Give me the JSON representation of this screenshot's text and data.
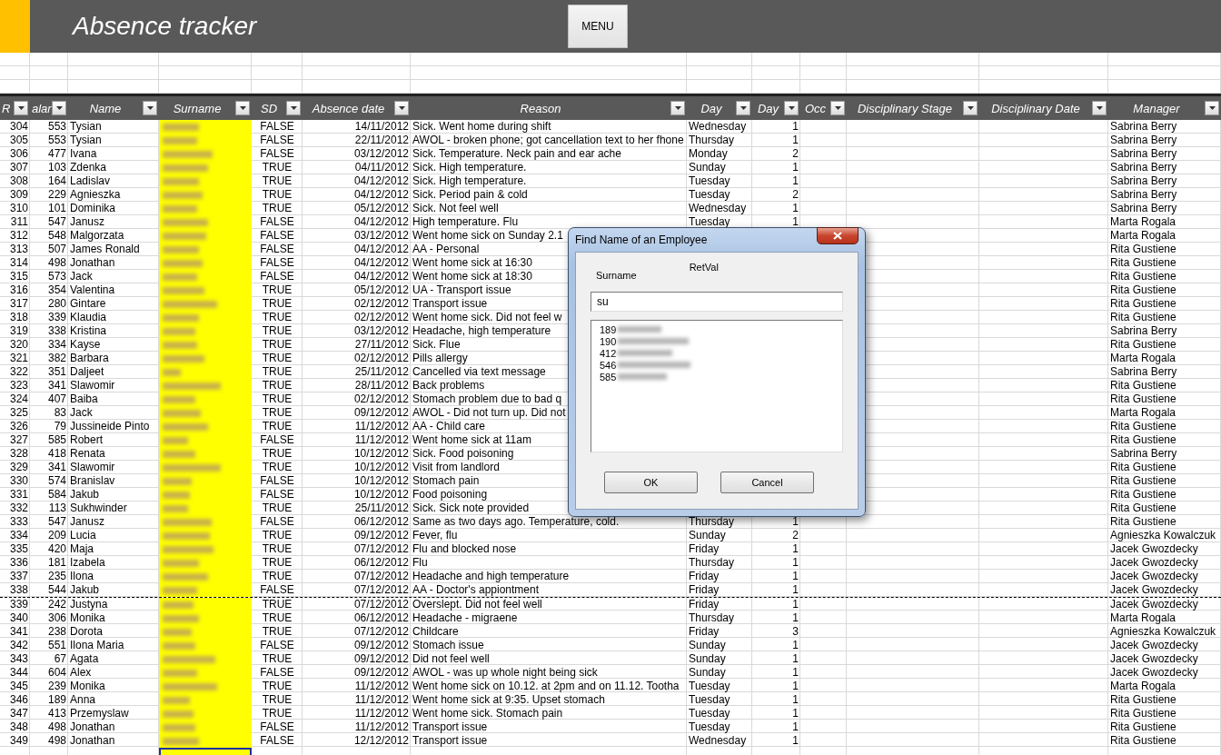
{
  "header": {
    "title": "Absence tracker",
    "menu_button": "MENU"
  },
  "table": {
    "columns": [
      "R",
      "alar",
      "Name",
      "Surname",
      "SD",
      "Absence date",
      "Reason",
      "Day",
      "Day",
      "Occ",
      "Disciplinary Stage",
      "Disciplinary Date",
      "Manager"
    ],
    "rows": [
      {
        "ref": "304",
        "salary": "553",
        "name": "Tysian",
        "sd": "FALSE",
        "date": "14/11/2012",
        "reason": "Sick. Went home during shift",
        "day": "Wednesday",
        "days": "1",
        "manager": "Sabrina Berry",
        "page_break": false
      },
      {
        "ref": "305",
        "salary": "553",
        "name": "Tysian",
        "sd": "FALSE",
        "date": "22/11/2012",
        "reason": "AWOL - broken phone; got cancellation text to her fhone",
        "day": "Thursday",
        "days": "1",
        "manager": "Sabrina Berry",
        "page_break": false
      },
      {
        "ref": "306",
        "salary": "477",
        "name": "Ivana",
        "sd": "FALSE",
        "date": "03/12/2012",
        "reason": "Sick. Temperature. Neck pain and ear ache",
        "day": "Monday",
        "days": "2",
        "manager": "Sabrina Berry",
        "page_break": false
      },
      {
        "ref": "307",
        "salary": "103",
        "name": "Zdenka",
        "sd": "TRUE",
        "date": "04/11/2012",
        "reason": "Sick. High temperature.",
        "day": "Sunday",
        "days": "1",
        "manager": "Sabrina Berry",
        "page_break": false
      },
      {
        "ref": "308",
        "salary": "164",
        "name": "Ladislav",
        "sd": "TRUE",
        "date": "04/12/2012",
        "reason": "Sick. High temperature.",
        "day": "Tuesday",
        "days": "1",
        "manager": "Sabrina Berry",
        "page_break": false
      },
      {
        "ref": "309",
        "salary": "229",
        "name": "Agnieszka",
        "sd": "TRUE",
        "date": "04/12/2012",
        "reason": "Sick. Period pain & cold",
        "day": "Tuesday",
        "days": "2",
        "manager": "Sabrina Berry",
        "page_break": false
      },
      {
        "ref": "310",
        "salary": "101",
        "name": "Dominika",
        "sd": "TRUE",
        "date": "05/12/2012",
        "reason": "Sick. Not feel well",
        "day": "Wednesday",
        "days": "1",
        "manager": "Sabrina Berry",
        "page_break": false
      },
      {
        "ref": "311",
        "salary": "547",
        "name": "Janusz",
        "sd": "FALSE",
        "date": "04/12/2012",
        "reason": "High temperature. Flu",
        "day": "Tuesday",
        "days": "1",
        "manager": "Marta Rogala",
        "page_break": false
      },
      {
        "ref": "312",
        "salary": "548",
        "name": "Malgorzata",
        "sd": "FALSE",
        "date": "03/12/2012",
        "reason": "Went home sick on Sunday 2.1",
        "manager": "Marta Rogala",
        "page_break": false
      },
      {
        "ref": "313",
        "salary": "507",
        "name": "James Ronald",
        "sd": "FALSE",
        "date": "04/12/2012",
        "reason": "AA - Personal",
        "manager": "Rita Gustiene",
        "page_break": false
      },
      {
        "ref": "314",
        "salary": "498",
        "name": "Jonathan",
        "sd": "FALSE",
        "date": "04/12/2012",
        "reason": "Went home sick at 16:30",
        "manager": "Rita Gustiene",
        "page_break": false
      },
      {
        "ref": "315",
        "salary": "573",
        "name": "Jack",
        "sd": "FALSE",
        "date": "04/12/2012",
        "reason": "Went home sick at 18:30",
        "manager": "Rita Gustiene",
        "page_break": false
      },
      {
        "ref": "316",
        "salary": "354",
        "name": "Valentina",
        "sd": "TRUE",
        "date": "05/12/2012",
        "reason": "UA - Transport issue",
        "manager": "Rita Gustiene",
        "page_break": false
      },
      {
        "ref": "317",
        "salary": "280",
        "name": "Gintare",
        "sd": "TRUE",
        "date": "02/12/2012",
        "reason": "Transport issue",
        "manager": "Rita Gustiene",
        "page_break": false
      },
      {
        "ref": "318",
        "salary": "339",
        "name": "Klaudia",
        "sd": "TRUE",
        "date": "02/12/2012",
        "reason": "Went home sick. Did not feel w",
        "manager": "Rita Gustiene",
        "page_break": false
      },
      {
        "ref": "319",
        "salary": "338",
        "name": "Kristina",
        "sd": "TRUE",
        "date": "03/12/2012",
        "reason": "Headache, high temperature",
        "manager": "Sabrina Berry",
        "page_break": false
      },
      {
        "ref": "320",
        "salary": "334",
        "name": "Kayse",
        "sd": "TRUE",
        "date": "27/11/2012",
        "reason": "Sick. Flue",
        "manager": "Rita Gustiene",
        "page_break": false
      },
      {
        "ref": "321",
        "salary": "382",
        "name": "Barbara",
        "sd": "TRUE",
        "date": "02/12/2012",
        "reason": "Pills allergy",
        "manager": "Marta Rogala",
        "page_break": false
      },
      {
        "ref": "322",
        "salary": "351",
        "name": "Daljeet",
        "sd": "TRUE",
        "date": "25/11/2012",
        "reason": "Cancelled via text message",
        "manager": "Sabrina Berry",
        "page_break": false
      },
      {
        "ref": "323",
        "salary": "341",
        "name": "Slawomir",
        "sd": "TRUE",
        "date": "28/11/2012",
        "reason": "Back problems",
        "manager": "Rita Gustiene",
        "page_break": false
      },
      {
        "ref": "324",
        "salary": "407",
        "name": "Baiba",
        "sd": "TRUE",
        "date": "02/12/2012",
        "reason": "Stomach problem due to bad q",
        "manager": "Rita Gustiene",
        "page_break": false
      },
      {
        "ref": "325",
        "salary": "83",
        "name": "Jack",
        "sd": "TRUE",
        "date": "09/12/2012",
        "reason": "AWOL - Did not turn up. Did not",
        "manager": "Marta Rogala",
        "page_break": false
      },
      {
        "ref": "326",
        "salary": "79",
        "name": "Jussineide Pinto",
        "sd": "TRUE",
        "date": "11/12/2012",
        "reason": "AA - Child care",
        "manager": "Rita Gustiene",
        "page_break": false
      },
      {
        "ref": "327",
        "salary": "585",
        "name": "Robert",
        "sd": "FALSE",
        "date": "11/12/2012",
        "reason": "Went home sick at 11am",
        "manager": "Rita Gustiene",
        "page_break": false
      },
      {
        "ref": "328",
        "salary": "418",
        "name": "Renata",
        "sd": "TRUE",
        "date": "10/12/2012",
        "reason": "Sick. Food poisoning",
        "manager": "Sabrina Berry",
        "page_break": false
      },
      {
        "ref": "329",
        "salary": "341",
        "name": "Slawomir",
        "sd": "TRUE",
        "date": "10/12/2012",
        "reason": "Visit from landlord",
        "manager": "Rita Gustiene",
        "page_break": false
      },
      {
        "ref": "330",
        "salary": "574",
        "name": "Branislav",
        "sd": "FALSE",
        "date": "10/12/2012",
        "reason": "Stomach pain",
        "manager": "Rita Gustiene",
        "page_break": false
      },
      {
        "ref": "331",
        "salary": "584",
        "name": "Jakub",
        "sd": "FALSE",
        "date": "10/12/2012",
        "reason": "Food poisoning",
        "manager": "Rita Gustiene",
        "page_break": false
      },
      {
        "ref": "332",
        "salary": "113",
        "name": "Sukhwinder",
        "sd": "TRUE",
        "date": "25/11/2012",
        "reason": "Sick. Sick note provided",
        "manager": "Rita Gustiene",
        "page_break": false
      },
      {
        "ref": "333",
        "salary": "547",
        "name": "Janusz",
        "sd": "FALSE",
        "date": "06/12/2012",
        "reason": "Same as two days ago. Temperature, cold.",
        "day": "Thursday",
        "days": "1",
        "manager": "Rita Gustiene",
        "page_break": false
      },
      {
        "ref": "334",
        "salary": "209",
        "name": "Lucia",
        "sd": "TRUE",
        "date": "09/12/2012",
        "reason": "Fever, flu",
        "day": "Sunday",
        "days": "2",
        "manager": "Agnieszka Kowalczuk",
        "page_break": false
      },
      {
        "ref": "335",
        "salary": "420",
        "name": "Maja",
        "sd": "TRUE",
        "date": "07/12/2012",
        "reason": "Flu and blocked nose",
        "day": "Friday",
        "days": "1",
        "manager": "Jacek Gwozdecky",
        "page_break": false
      },
      {
        "ref": "336",
        "salary": "181",
        "name": "Izabela",
        "sd": "TRUE",
        "date": "06/12/2012",
        "reason": "Flu",
        "day": "Thursday",
        "days": "1",
        "manager": "Jacek Gwozdecky",
        "page_break": false
      },
      {
        "ref": "337",
        "salary": "235",
        "name": "Ilona",
        "sd": "TRUE",
        "date": "07/12/2012",
        "reason": "Headache and high temperature",
        "day": "Friday",
        "days": "1",
        "manager": "Jacek Gwozdecky",
        "page_break": false
      },
      {
        "ref": "338",
        "salary": "544",
        "name": "Jakub",
        "sd": "FALSE",
        "date": "07/12/2012",
        "reason": "AA - Doctor's appiontment",
        "day": "Friday",
        "days": "1",
        "manager": "Jacek Gwozdecky",
        "page_break": false
      },
      {
        "ref": "339",
        "salary": "242",
        "name": "Justyna",
        "sd": "TRUE",
        "date": "07/12/2012",
        "reason": "Overslept. Did not feel well",
        "day": "Friday",
        "days": "1",
        "manager": "Jacek Gwozdecky",
        "page_break": true
      },
      {
        "ref": "340",
        "salary": "306",
        "name": "Monika",
        "sd": "TRUE",
        "date": "06/12/2012",
        "reason": "Headache - migraene",
        "day": "Thursday",
        "days": "1",
        "manager": "Marta Rogala",
        "page_break": false
      },
      {
        "ref": "341",
        "salary": "238",
        "name": "Dorota",
        "sd": "TRUE",
        "date": "07/12/2012",
        "reason": "Childcare",
        "day": "Friday",
        "days": "3",
        "manager": "Agnieszka Kowalczuk",
        "page_break": false
      },
      {
        "ref": "342",
        "salary": "551",
        "name": "Ilona Maria",
        "sd": "FALSE",
        "date": "09/12/2012",
        "reason": "Stomach issue",
        "day": "Sunday",
        "days": "1",
        "manager": "Jacek Gwozdecky",
        "page_break": false
      },
      {
        "ref": "343",
        "salary": "67",
        "name": "Agata",
        "sd": "TRUE",
        "date": "09/12/2012",
        "reason": "Did not feel well",
        "day": "Sunday",
        "days": "1",
        "manager": "Jacek Gwozdecky",
        "page_break": false
      },
      {
        "ref": "344",
        "salary": "604",
        "name": "Alex",
        "sd": "FALSE",
        "date": "09/12/2012",
        "reason": "AWOL - was up whole night being sick",
        "day": "Sunday",
        "days": "1",
        "manager": "Jacek Gwozdecky",
        "page_break": false
      },
      {
        "ref": "345",
        "salary": "239",
        "name": "Monika",
        "sd": "TRUE",
        "date": "11/12/2012",
        "reason": "Went home sick on 10.12. at 2pm and on 11.12. Tootha",
        "day": "Tuesday",
        "days": "1",
        "manager": "Marta Rogala",
        "page_break": false
      },
      {
        "ref": "346",
        "salary": "189",
        "name": "Anna",
        "sd": "TRUE",
        "date": "11/12/2012",
        "reason": "Went home sick at 9:35. Upset stomach",
        "day": "Tuesday",
        "days": "1",
        "manager": "Rita Gustiene",
        "page_break": false
      },
      {
        "ref": "347",
        "salary": "413",
        "name": "Przemyslaw",
        "sd": "TRUE",
        "date": "11/12/2012",
        "reason": "Went home sick. Stomach pain",
        "day": "Tuesday",
        "days": "1",
        "manager": "Rita Gustiene",
        "page_break": false
      },
      {
        "ref": "348",
        "salary": "498",
        "name": "Jonathan",
        "sd": "FALSE",
        "date": "11/12/2012",
        "reason": "Transport issue",
        "day": "Tuesday",
        "days": "1",
        "manager": "Rita Gustiene",
        "page_break": false
      },
      {
        "ref": "349",
        "salary": "498",
        "name": "Jonathan",
        "sd": "FALSE",
        "date": "12/12/2012",
        "reason": "Transport issue",
        "day": "Wednesday",
        "days": "1",
        "manager": "Rita Gustiene",
        "page_break": false
      }
    ]
  },
  "dialog": {
    "title": "Find Name of an Employee",
    "surname_label": "Surname",
    "retval_label": "RetVal",
    "search": {
      "value": "su"
    },
    "results": [
      {
        "id": "189"
      },
      {
        "id": "190"
      },
      {
        "id": "412"
      },
      {
        "id": "546"
      },
      {
        "id": "585"
      }
    ],
    "buttons": [
      "OK",
      "Cancel"
    ]
  }
}
